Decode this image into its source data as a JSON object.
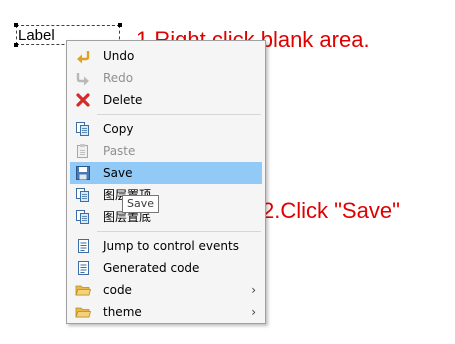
{
  "canvas": {
    "label_widget_text": "Label"
  },
  "annotations": {
    "step1": "1.Right click blank area.",
    "step2": "2.Click \"Save\"",
    "color": "#e00000"
  },
  "context_menu": {
    "items": {
      "undo": {
        "label": "Undo",
        "enabled": true,
        "icon": "undo-icon"
      },
      "redo": {
        "label": "Redo",
        "enabled": false,
        "icon": "redo-icon"
      },
      "delete": {
        "label": "Delete",
        "enabled": true,
        "icon": "delete-icon"
      },
      "copy": {
        "label": "Copy",
        "enabled": true,
        "icon": "copy-icon"
      },
      "paste": {
        "label": "Paste",
        "enabled": false,
        "icon": "paste-icon"
      },
      "save": {
        "label": "Save",
        "enabled": true,
        "highlighted": true,
        "icon": "save-icon"
      },
      "layer_top": {
        "label": "图层置顶",
        "enabled": true,
        "icon": "bring-to-front-icon"
      },
      "layer_bottom": {
        "label": "图层置底",
        "enabled": true,
        "icon": "send-to-back-icon"
      },
      "jump_events": {
        "label": "Jump to control events",
        "enabled": true,
        "icon": "document-icon"
      },
      "generated_code": {
        "label": "Generated code",
        "enabled": true,
        "icon": "document-icon"
      },
      "code": {
        "label": "code",
        "enabled": true,
        "icon": "folder-icon",
        "submenu": true
      },
      "theme": {
        "label": "theme",
        "enabled": true,
        "icon": "folder-icon",
        "submenu": true
      }
    },
    "highlight_color": "#91c9f7"
  },
  "tooltip": {
    "text": "Save"
  }
}
